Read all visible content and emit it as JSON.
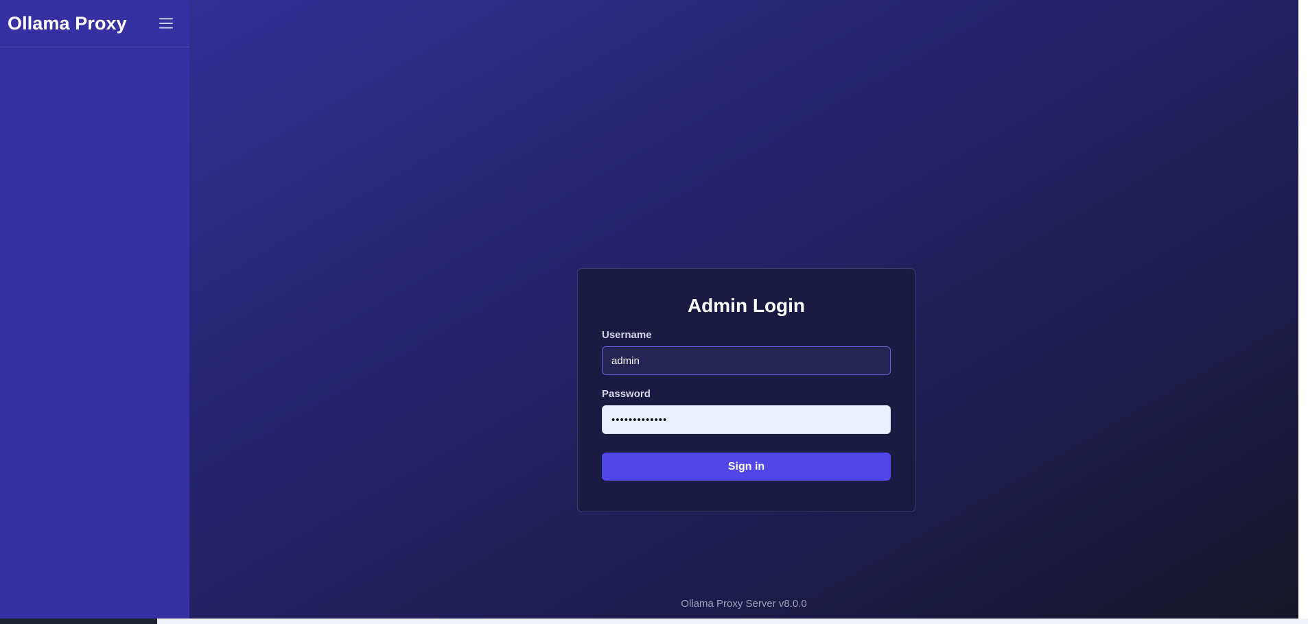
{
  "sidebar": {
    "brand": "Ollama Proxy",
    "menu_icon": "hamburger-menu-icon"
  },
  "login": {
    "title": "Admin Login",
    "username_label": "Username",
    "username_value": "admin",
    "password_label": "Password",
    "password_value": "•••••••••••••",
    "signin_label": "Sign in"
  },
  "footer": {
    "version_text": "Ollama Proxy Server v8.0.0"
  },
  "colors": {
    "sidebar_bg": "#3730a3",
    "primary_button": "#4f46e5",
    "card_bg": "#1b1a42"
  }
}
